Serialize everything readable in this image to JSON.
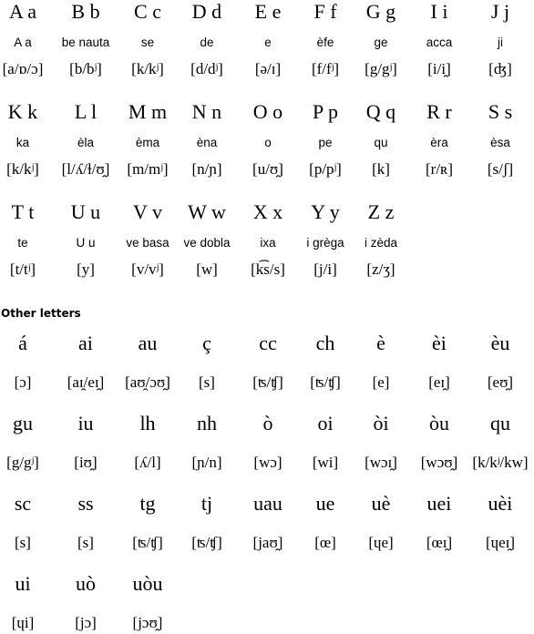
{
  "alphabet": [
    {
      "letter": "A a",
      "name": "A a",
      "ipa": "[a/ɒ/ɔ]"
    },
    {
      "letter": "B b",
      "name": "be nauta",
      "ipa": "[b/bʲ]"
    },
    {
      "letter": "C c",
      "name": "se",
      "ipa": "[k/kʲ]"
    },
    {
      "letter": "D d",
      "name": "de",
      "ipa": "[d/dʲ]"
    },
    {
      "letter": "E e",
      "name": "e",
      "ipa": "[ə/ɪ]"
    },
    {
      "letter": "F f",
      "name": "èfe",
      "ipa": "[f/fʲ]"
    },
    {
      "letter": "G g",
      "name": "ge",
      "ipa": "[g/gʲ]"
    },
    {
      "letter": "I i",
      "name": "acca",
      "ipa": "[i/i̯]"
    },
    {
      "letter": "J j",
      "name": "ji",
      "ipa": "[ʤ]"
    },
    {
      "letter": "K k",
      "name": "ka",
      "ipa": "[k/kʲ]"
    },
    {
      "letter": "L l",
      "name": "èla",
      "ipa": "[l/ʎ/ɫ/ʊ̯]"
    },
    {
      "letter": "M m",
      "name": "èma",
      "ipa": "[m/mʲ]"
    },
    {
      "letter": "N n",
      "name": "èna",
      "ipa": "[n/ɲ]"
    },
    {
      "letter": "O o",
      "name": "o",
      "ipa": "[u/ʊ̯]"
    },
    {
      "letter": "P p",
      "name": "pe",
      "ipa": "[p/pʲ]"
    },
    {
      "letter": "Q q",
      "name": "qu",
      "ipa": "[k]"
    },
    {
      "letter": "R r",
      "name": "èra",
      "ipa": "[r/ʀ]"
    },
    {
      "letter": "S s",
      "name": "èsa",
      "ipa": "[s/ʃ]"
    },
    {
      "letter": "T t",
      "name": "te",
      "ipa": "[t/tʲ]"
    },
    {
      "letter": "U u",
      "name": "U u",
      "ipa": "[y]"
    },
    {
      "letter": "V v",
      "name": "ve basa",
      "ipa": "[v/vʲ]"
    },
    {
      "letter": "W w",
      "name": "ve dobla",
      "ipa": "[w]"
    },
    {
      "letter": "X x",
      "name": "ixa",
      "ipa": "[k͡s/s]"
    },
    {
      "letter": "Y y",
      "name": "i grèga",
      "ipa": "[j/i]"
    },
    {
      "letter": "Z z",
      "name": "i zèda",
      "ipa": "[z/ʒ]"
    }
  ],
  "other_letters": {
    "title": "Other letters",
    "items": [
      {
        "letter": "á",
        "ipa": "[ɔ]"
      },
      {
        "letter": "ai",
        "ipa": "[aɪ̯/eɪ̯]"
      },
      {
        "letter": "au",
        "ipa": "[aʊ̯/ɔʊ̯]"
      },
      {
        "letter": "ç",
        "ipa": "[s]"
      },
      {
        "letter": "cc",
        "ipa": "[ʦ/ʧ]"
      },
      {
        "letter": "ch",
        "ipa": "[ʦ/ʧ]"
      },
      {
        "letter": "è",
        "ipa": "[e]"
      },
      {
        "letter": "èi",
        "ipa": "[eɪ̯]"
      },
      {
        "letter": "èu",
        "ipa": "[eʊ̯]"
      },
      {
        "letter": "gu",
        "ipa": "[g/gʲ]"
      },
      {
        "letter": "iu",
        "ipa": "[iʊ̯]"
      },
      {
        "letter": "lh",
        "ipa": "[ʎ/l]"
      },
      {
        "letter": "nh",
        "ipa": "[ɲ/n]"
      },
      {
        "letter": "ò",
        "ipa": "[wɔ]"
      },
      {
        "letter": "oi",
        "ipa": "[wi]"
      },
      {
        "letter": "òi",
        "ipa": "[wɔɪ̯]"
      },
      {
        "letter": "òu",
        "ipa": "[wɔʊ̯]"
      },
      {
        "letter": "qu",
        "ipa": "[k/kʲ/kw]"
      },
      {
        "letter": "sc",
        "ipa": "[s]"
      },
      {
        "letter": "ss",
        "ipa": "[s]"
      },
      {
        "letter": "tg",
        "ipa": "[ʦ/ʧ]"
      },
      {
        "letter": "tj",
        "ipa": "[ʦ/ʧ]"
      },
      {
        "letter": "uau",
        "ipa": "[jaʊ̯]"
      },
      {
        "letter": "ue",
        "ipa": "[œ]"
      },
      {
        "letter": "uè",
        "ipa": "[ɥe]"
      },
      {
        "letter": "uei",
        "ipa": "[œɪ̯]"
      },
      {
        "letter": "uèi",
        "ipa": "[ɥeɪ̯]"
      },
      {
        "letter": "ui",
        "ipa": "[ɥi]"
      },
      {
        "letter": "uò",
        "ipa": "[jɔ]"
      },
      {
        "letter": "uòu",
        "ipa": "[jɔʊ̯]"
      }
    ]
  }
}
